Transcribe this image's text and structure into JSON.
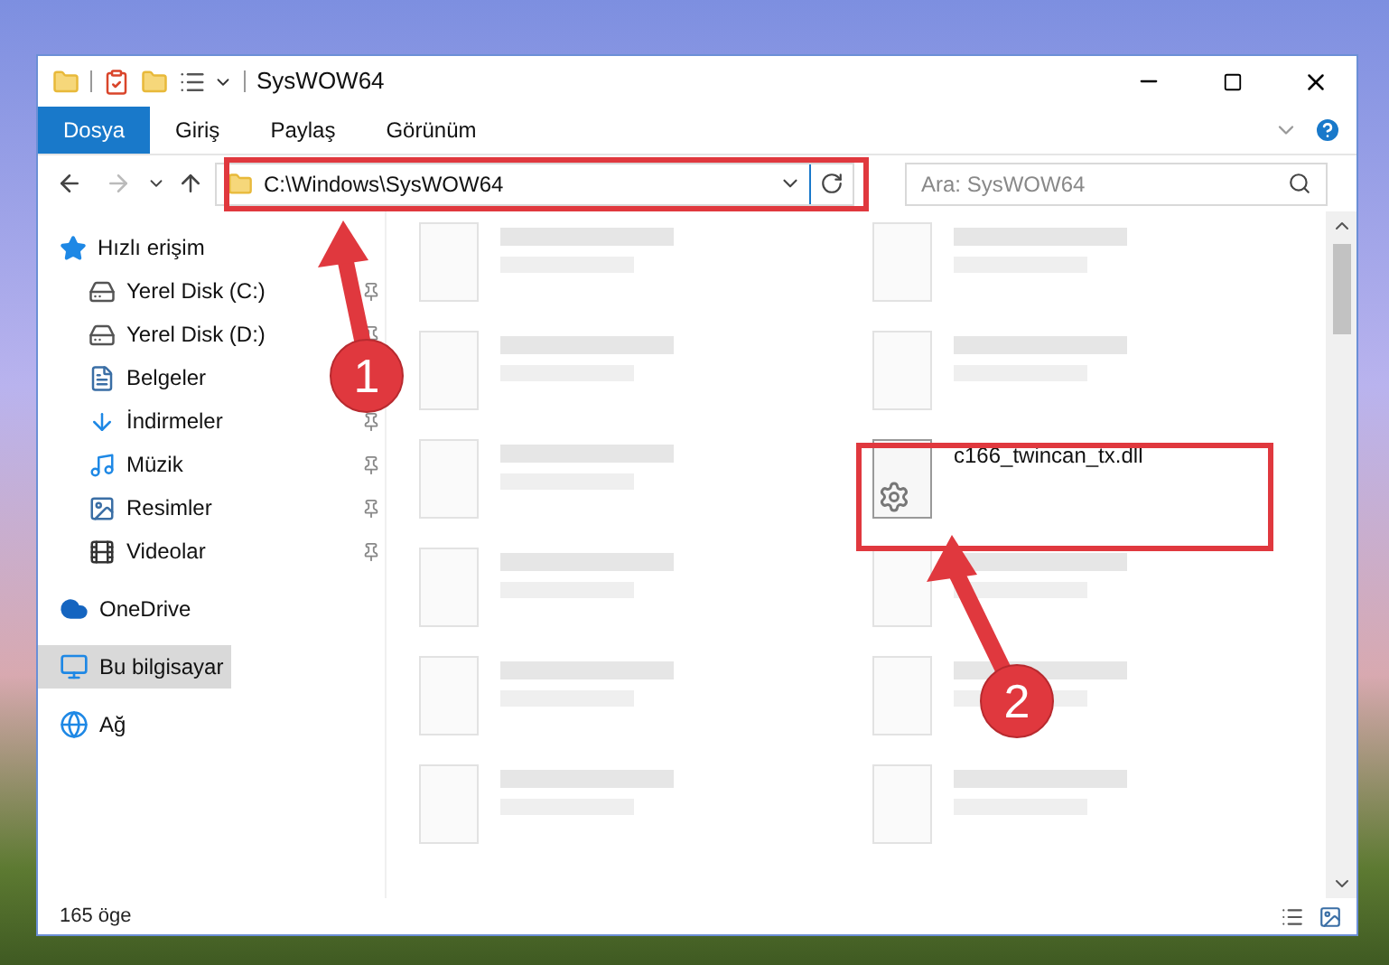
{
  "window": {
    "title": "SysWOW64"
  },
  "ribbon_tabs": [
    {
      "label": "Dosya",
      "selected": true
    },
    {
      "label": "Giriş",
      "selected": false
    },
    {
      "label": "Paylaş",
      "selected": false
    },
    {
      "label": "Görünüm",
      "selected": false
    }
  ],
  "address_bar": {
    "path": "C:\\Windows\\SysWOW64"
  },
  "search": {
    "placeholder": "Ara: SysWOW64"
  },
  "sidebar": {
    "items": [
      {
        "label": "Hızlı erişim",
        "kind": "quick",
        "selected": false,
        "children": [
          {
            "label": "Yerel Disk (C:)",
            "kind": "disk",
            "pinned": true,
            "selected": false
          },
          {
            "label": "Yerel Disk (D:)",
            "kind": "disk",
            "pinned": true,
            "selected": false
          },
          {
            "label": "Belgeler",
            "kind": "docs",
            "selected": false
          },
          {
            "label": "İndirmeler",
            "kind": "downloads",
            "pinned": true,
            "selected": false
          },
          {
            "label": "Müzik",
            "kind": "music",
            "pinned": true,
            "selected": false
          },
          {
            "label": "Resimler",
            "kind": "pictures",
            "pinned": true,
            "selected": false
          },
          {
            "label": "Videolar",
            "kind": "videos",
            "pinned": true,
            "selected": false
          }
        ]
      },
      {
        "label": "OneDrive",
        "kind": "cloud",
        "selected": false
      },
      {
        "label": "Bu bilgisayar",
        "kind": "pc",
        "selected": true
      },
      {
        "label": "Ağ",
        "kind": "network",
        "selected": false
      }
    ]
  },
  "files": [
    {
      "kind": "blurred"
    },
    {
      "kind": "blurred"
    },
    {
      "kind": "blurred"
    },
    {
      "kind": "blurred"
    },
    {
      "kind": "blurred"
    },
    {
      "kind": "file",
      "name": "c166_twincan_tx.dll"
    },
    {
      "kind": "blurred"
    },
    {
      "kind": "blurred"
    },
    {
      "kind": "blurred"
    },
    {
      "kind": "blurred"
    },
    {
      "kind": "blurred"
    },
    {
      "kind": "blurred"
    }
  ],
  "status_bar": {
    "count": "165 öge"
  },
  "annotations": [
    {
      "label": "1"
    },
    {
      "label": "2"
    }
  ]
}
